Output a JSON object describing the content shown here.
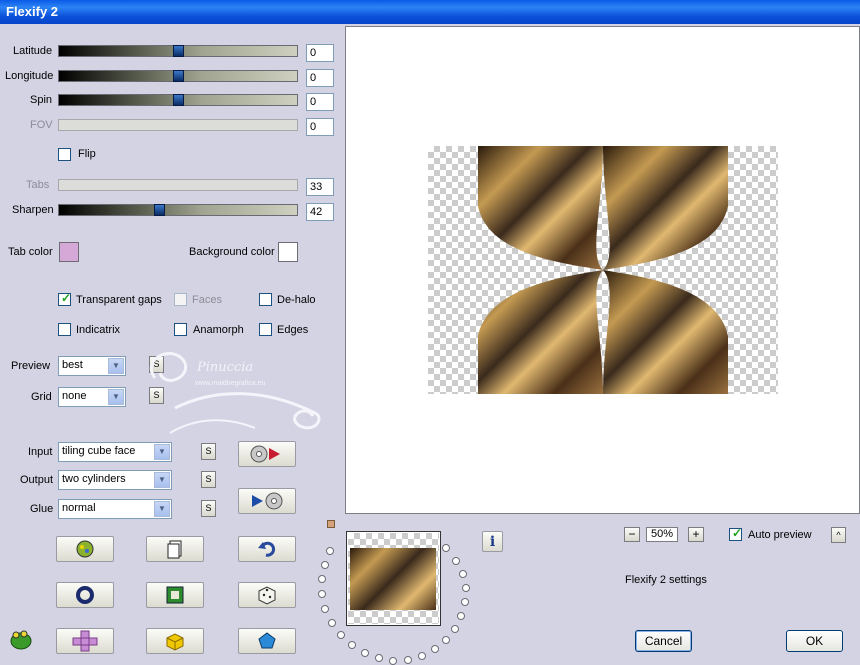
{
  "window": {
    "title": "Flexify 2"
  },
  "sliders": [
    {
      "label": "Latitude",
      "value": "0",
      "enabled": true,
      "level": 0.5
    },
    {
      "label": "Longitude",
      "value": "0",
      "enabled": true,
      "level": 0.5
    },
    {
      "label": "Spin",
      "value": "0",
      "enabled": true,
      "level": 0.5
    },
    {
      "label": "FOV",
      "value": "0",
      "enabled": false
    }
  ],
  "flip": {
    "label": "Flip",
    "checked": false
  },
  "tabs": {
    "label": "Tabs",
    "value": "33",
    "enabled": false
  },
  "sharpen": {
    "label": "Sharpen",
    "value": "42",
    "level": 0.42
  },
  "colors": {
    "tab_label": "Tab color",
    "tab_color": "#d6a8d8",
    "background_label": "Background color",
    "background_color": "#ffffff"
  },
  "options": {
    "transparent_gaps": {
      "label": "Transparent gaps",
      "checked": true
    },
    "faces": {
      "label": "Faces",
      "checked": false,
      "enabled": false
    },
    "de_halo": {
      "label": "De-halo",
      "checked": false
    },
    "indicatrix": {
      "label": "Indicatrix",
      "checked": false
    },
    "anamorph": {
      "label": "Anamorph",
      "checked": false
    },
    "edges": {
      "label": "Edges",
      "checked": false
    }
  },
  "preview_select": {
    "label": "Preview",
    "value": "best"
  },
  "grid_select": {
    "label": "Grid",
    "value": "none"
  },
  "input_select": {
    "label": "Input",
    "value": "tiling cube face"
  },
  "output_select": {
    "label": "Output",
    "value": "two cylinders"
  },
  "glue_select": {
    "label": "Glue",
    "value": "normal"
  },
  "s_button_label": "S",
  "watermark": {
    "name": "Pinuccia",
    "url": "www.maidiregrafica.eu"
  },
  "zoom": {
    "value": "50%",
    "minus": "−",
    "plus": "+"
  },
  "auto_preview": {
    "label": "Auto preview",
    "checked": true
  },
  "info_label": "i",
  "collapse_label": "^",
  "settings_label": "Flexify 2 settings",
  "buttons": {
    "cancel": "Cancel",
    "ok": "OK"
  },
  "accent": "#0a5ae6"
}
